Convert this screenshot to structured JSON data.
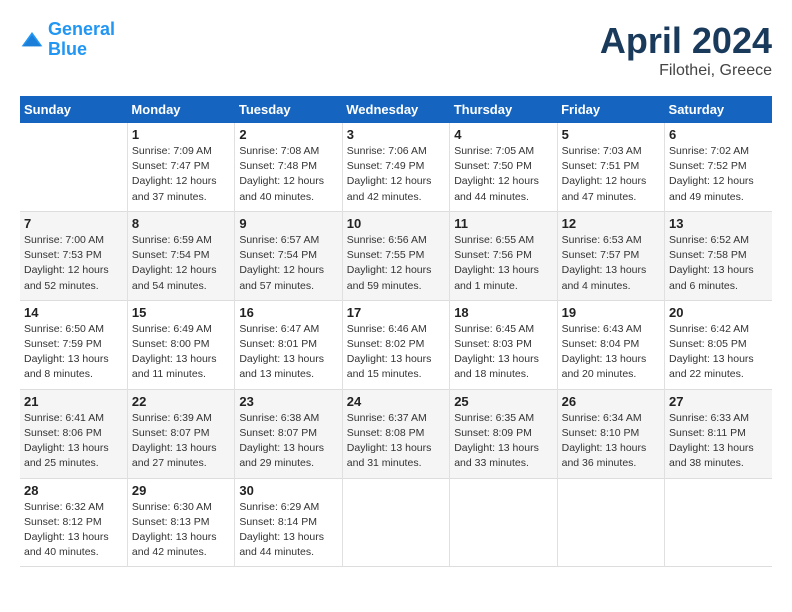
{
  "header": {
    "logo_line1": "General",
    "logo_line2": "Blue",
    "month_year": "April 2024",
    "location": "Filothei, Greece"
  },
  "weekdays": [
    "Sunday",
    "Monday",
    "Tuesday",
    "Wednesday",
    "Thursday",
    "Friday",
    "Saturday"
  ],
  "weeks": [
    [
      {
        "num": "",
        "info": ""
      },
      {
        "num": "1",
        "info": "Sunrise: 7:09 AM\nSunset: 7:47 PM\nDaylight: 12 hours\nand 37 minutes."
      },
      {
        "num": "2",
        "info": "Sunrise: 7:08 AM\nSunset: 7:48 PM\nDaylight: 12 hours\nand 40 minutes."
      },
      {
        "num": "3",
        "info": "Sunrise: 7:06 AM\nSunset: 7:49 PM\nDaylight: 12 hours\nand 42 minutes."
      },
      {
        "num": "4",
        "info": "Sunrise: 7:05 AM\nSunset: 7:50 PM\nDaylight: 12 hours\nand 44 minutes."
      },
      {
        "num": "5",
        "info": "Sunrise: 7:03 AM\nSunset: 7:51 PM\nDaylight: 12 hours\nand 47 minutes."
      },
      {
        "num": "6",
        "info": "Sunrise: 7:02 AM\nSunset: 7:52 PM\nDaylight: 12 hours\nand 49 minutes."
      }
    ],
    [
      {
        "num": "7",
        "info": "Sunrise: 7:00 AM\nSunset: 7:53 PM\nDaylight: 12 hours\nand 52 minutes."
      },
      {
        "num": "8",
        "info": "Sunrise: 6:59 AM\nSunset: 7:54 PM\nDaylight: 12 hours\nand 54 minutes."
      },
      {
        "num": "9",
        "info": "Sunrise: 6:57 AM\nSunset: 7:54 PM\nDaylight: 12 hours\nand 57 minutes."
      },
      {
        "num": "10",
        "info": "Sunrise: 6:56 AM\nSunset: 7:55 PM\nDaylight: 12 hours\nand 59 minutes."
      },
      {
        "num": "11",
        "info": "Sunrise: 6:55 AM\nSunset: 7:56 PM\nDaylight: 13 hours\nand 1 minute."
      },
      {
        "num": "12",
        "info": "Sunrise: 6:53 AM\nSunset: 7:57 PM\nDaylight: 13 hours\nand 4 minutes."
      },
      {
        "num": "13",
        "info": "Sunrise: 6:52 AM\nSunset: 7:58 PM\nDaylight: 13 hours\nand 6 minutes."
      }
    ],
    [
      {
        "num": "14",
        "info": "Sunrise: 6:50 AM\nSunset: 7:59 PM\nDaylight: 13 hours\nand 8 minutes."
      },
      {
        "num": "15",
        "info": "Sunrise: 6:49 AM\nSunset: 8:00 PM\nDaylight: 13 hours\nand 11 minutes."
      },
      {
        "num": "16",
        "info": "Sunrise: 6:47 AM\nSunset: 8:01 PM\nDaylight: 13 hours\nand 13 minutes."
      },
      {
        "num": "17",
        "info": "Sunrise: 6:46 AM\nSunset: 8:02 PM\nDaylight: 13 hours\nand 15 minutes."
      },
      {
        "num": "18",
        "info": "Sunrise: 6:45 AM\nSunset: 8:03 PM\nDaylight: 13 hours\nand 18 minutes."
      },
      {
        "num": "19",
        "info": "Sunrise: 6:43 AM\nSunset: 8:04 PM\nDaylight: 13 hours\nand 20 minutes."
      },
      {
        "num": "20",
        "info": "Sunrise: 6:42 AM\nSunset: 8:05 PM\nDaylight: 13 hours\nand 22 minutes."
      }
    ],
    [
      {
        "num": "21",
        "info": "Sunrise: 6:41 AM\nSunset: 8:06 PM\nDaylight: 13 hours\nand 25 minutes."
      },
      {
        "num": "22",
        "info": "Sunrise: 6:39 AM\nSunset: 8:07 PM\nDaylight: 13 hours\nand 27 minutes."
      },
      {
        "num": "23",
        "info": "Sunrise: 6:38 AM\nSunset: 8:07 PM\nDaylight: 13 hours\nand 29 minutes."
      },
      {
        "num": "24",
        "info": "Sunrise: 6:37 AM\nSunset: 8:08 PM\nDaylight: 13 hours\nand 31 minutes."
      },
      {
        "num": "25",
        "info": "Sunrise: 6:35 AM\nSunset: 8:09 PM\nDaylight: 13 hours\nand 33 minutes."
      },
      {
        "num": "26",
        "info": "Sunrise: 6:34 AM\nSunset: 8:10 PM\nDaylight: 13 hours\nand 36 minutes."
      },
      {
        "num": "27",
        "info": "Sunrise: 6:33 AM\nSunset: 8:11 PM\nDaylight: 13 hours\nand 38 minutes."
      }
    ],
    [
      {
        "num": "28",
        "info": "Sunrise: 6:32 AM\nSunset: 8:12 PM\nDaylight: 13 hours\nand 40 minutes."
      },
      {
        "num": "29",
        "info": "Sunrise: 6:30 AM\nSunset: 8:13 PM\nDaylight: 13 hours\nand 42 minutes."
      },
      {
        "num": "30",
        "info": "Sunrise: 6:29 AM\nSunset: 8:14 PM\nDaylight: 13 hours\nand 44 minutes."
      },
      {
        "num": "",
        "info": ""
      },
      {
        "num": "",
        "info": ""
      },
      {
        "num": "",
        "info": ""
      },
      {
        "num": "",
        "info": ""
      }
    ]
  ]
}
